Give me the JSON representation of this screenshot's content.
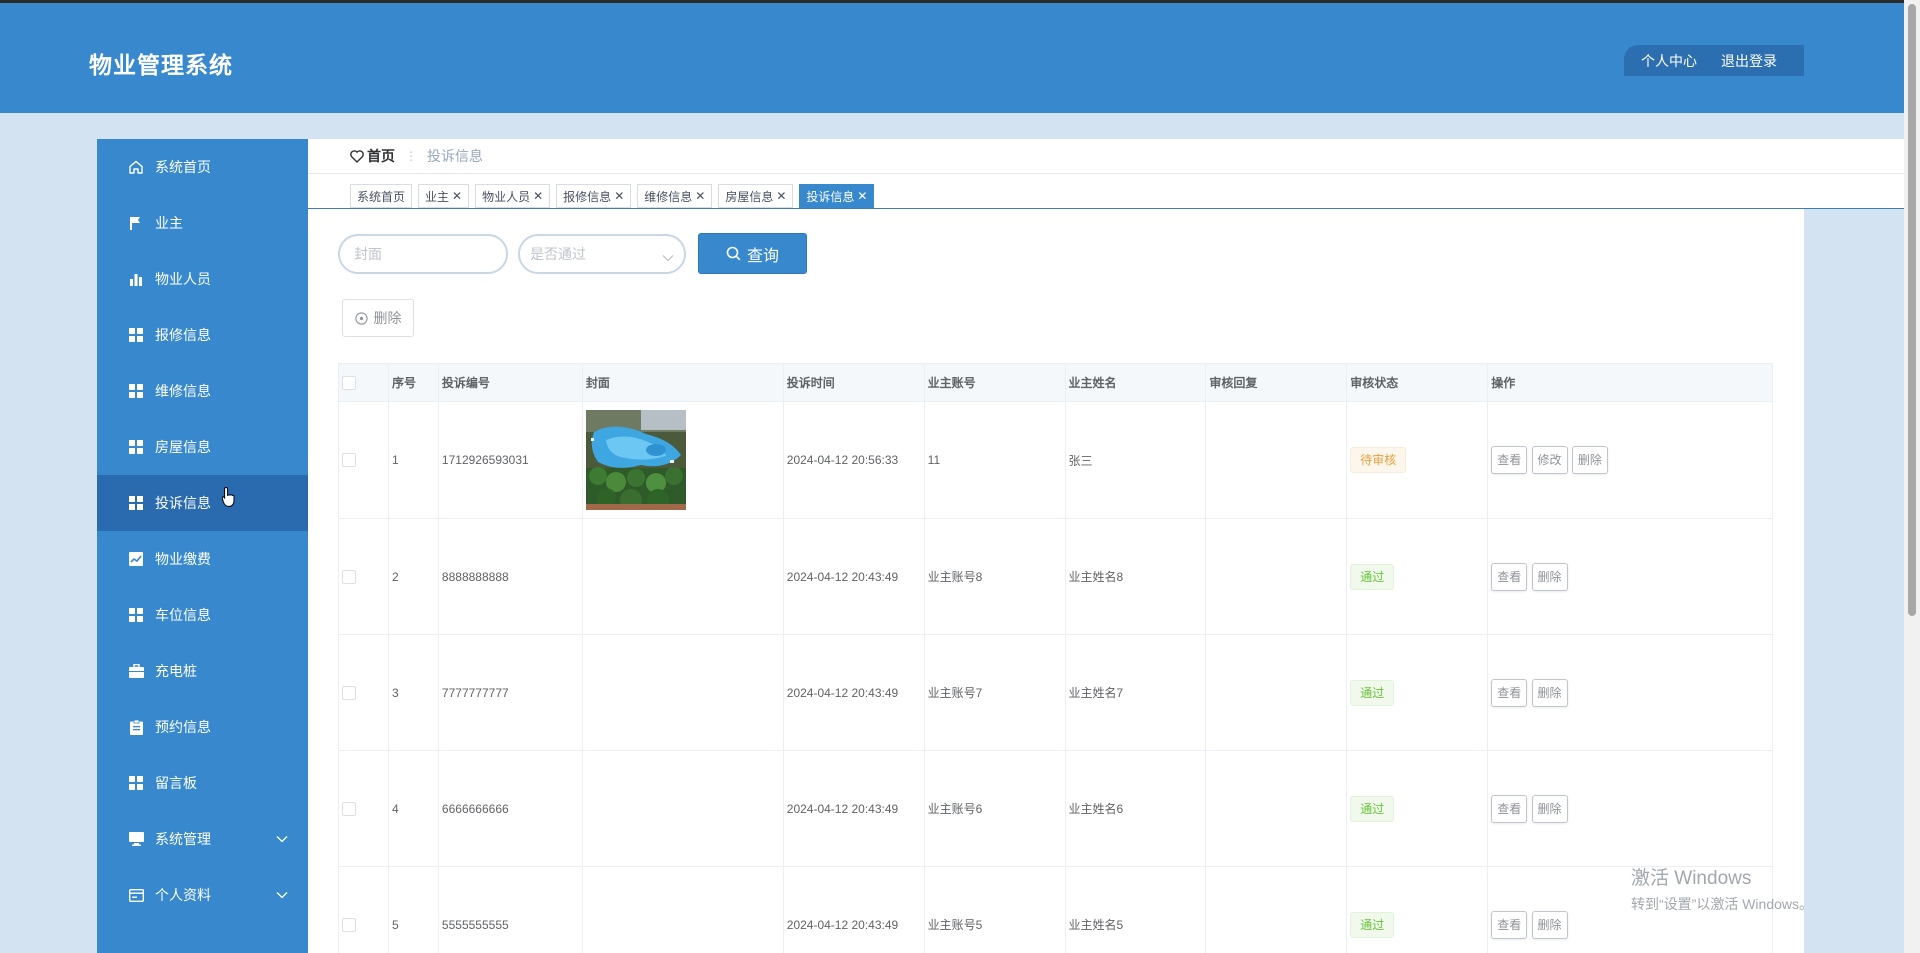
{
  "app": {
    "title": "物业管理系统"
  },
  "top_menu": {
    "profile": "个人中心",
    "logout": "退出登录"
  },
  "sidebar": {
    "items": [
      {
        "label": "系统首页",
        "icon": "home-icon"
      },
      {
        "label": "业主",
        "icon": "flag-icon"
      },
      {
        "label": "物业人员",
        "icon": "bar-chart-icon"
      },
      {
        "label": "报修信息",
        "icon": "grid-icon"
      },
      {
        "label": "维修信息",
        "icon": "grid-icon"
      },
      {
        "label": "房屋信息",
        "icon": "grid-icon"
      },
      {
        "label": "投诉信息",
        "icon": "grid-icon",
        "active": true
      },
      {
        "label": "物业缴费",
        "icon": "line-chart-icon"
      },
      {
        "label": "车位信息",
        "icon": "grid-icon"
      },
      {
        "label": "充电桩",
        "icon": "briefcase-icon"
      },
      {
        "label": "预约信息",
        "icon": "clipboard-icon"
      },
      {
        "label": "留言板",
        "icon": "grid-icon"
      },
      {
        "label": "系统管理",
        "icon": "monitor-icon",
        "expandable": true
      },
      {
        "label": "个人资料",
        "icon": "id-card-icon",
        "expandable": true
      }
    ]
  },
  "breadcrumb": {
    "home": "首页",
    "current": "投诉信息"
  },
  "tabs": [
    {
      "label": "系统首页",
      "closable": false
    },
    {
      "label": "业主",
      "closable": true
    },
    {
      "label": "物业人员",
      "closable": true
    },
    {
      "label": "报修信息",
      "closable": true
    },
    {
      "label": "维修信息",
      "closable": true
    },
    {
      "label": "房屋信息",
      "closable": true
    },
    {
      "label": "投诉信息",
      "closable": true,
      "active": true
    }
  ],
  "search": {
    "cover_placeholder": "封面",
    "status_placeholder": "是否通过",
    "query_label": "查询"
  },
  "toolbar": {
    "delete_label": "删除"
  },
  "table": {
    "headers": [
      "序号",
      "投诉编号",
      "封面",
      "投诉时间",
      "业主账号",
      "业主姓名",
      "审核回复",
      "审核状态",
      "操作"
    ],
    "rows": [
      {
        "index": "1",
        "code": "1712926593031",
        "has_cover": true,
        "time": "2024-04-12 20:56:33",
        "account": "11",
        "name": "张三",
        "reply": "",
        "status": "待审核",
        "status_type": "pending",
        "actions": [
          "查看",
          "修改",
          "删除"
        ]
      },
      {
        "index": "2",
        "code": "8888888888",
        "has_cover": false,
        "time": "2024-04-12 20:43:49",
        "account": "业主账号8",
        "name": "业主姓名8",
        "reply": "",
        "status": "通过",
        "status_type": "pass",
        "actions": [
          "查看",
          "删除"
        ]
      },
      {
        "index": "3",
        "code": "7777777777",
        "has_cover": false,
        "time": "2024-04-12 20:43:49",
        "account": "业主账号7",
        "name": "业主姓名7",
        "reply": "",
        "status": "通过",
        "status_type": "pass",
        "actions": [
          "查看",
          "删除"
        ]
      },
      {
        "index": "4",
        "code": "6666666666",
        "has_cover": false,
        "time": "2024-04-12 20:43:49",
        "account": "业主账号6",
        "name": "业主姓名6",
        "reply": "",
        "status": "通过",
        "status_type": "pass",
        "actions": [
          "查看",
          "删除"
        ]
      },
      {
        "index": "5",
        "code": "5555555555",
        "has_cover": false,
        "time": "2024-04-12 20:43:49",
        "account": "业主账号5",
        "name": "业主姓名5",
        "reply": "",
        "status": "通过",
        "status_type": "pass",
        "actions": [
          "查看",
          "删除"
        ]
      }
    ]
  },
  "watermark": {
    "line1": "激活 Windows",
    "line2": "转到“设置”以激活 Windows。"
  },
  "colors": {
    "primary": "#3788cc",
    "sidebar_active": "#2a6bb0",
    "page_bg": "#d3e3f2"
  }
}
